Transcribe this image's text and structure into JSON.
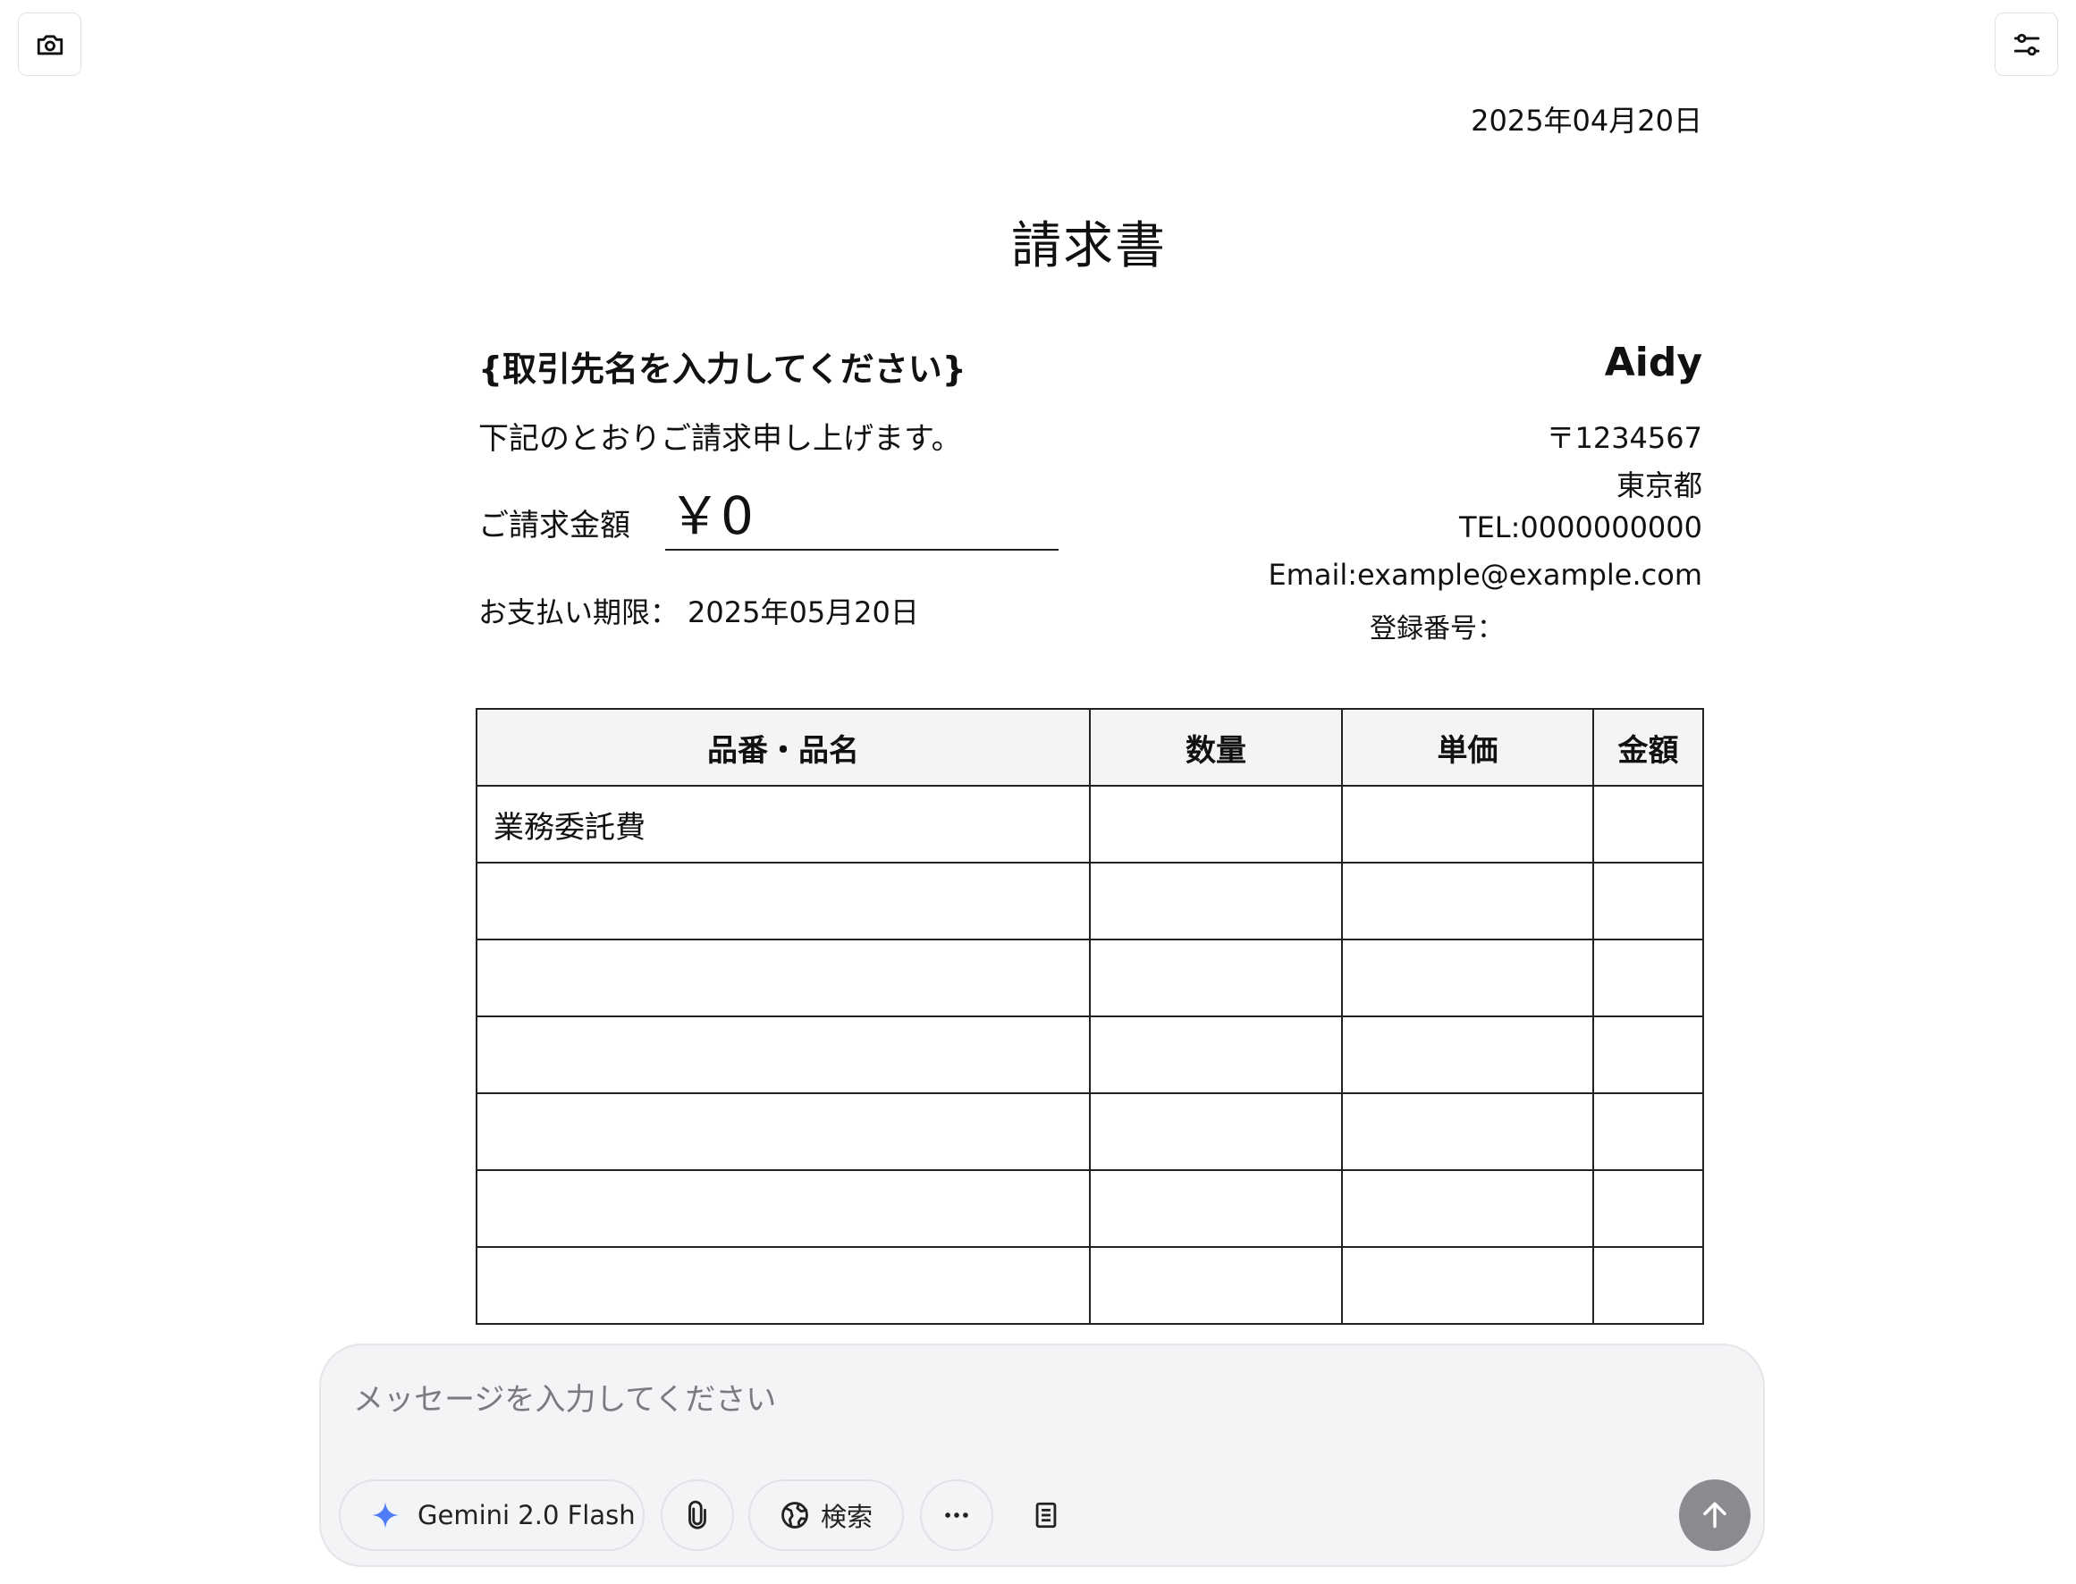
{
  "icons": {
    "camera": "camera-icon",
    "filter": "sliders-icon",
    "model": "sparkle-icon",
    "attach": "paperclip-icon",
    "search": "globe-icon",
    "more": "more-dots-icon",
    "document": "document-icon",
    "send": "arrow-up-icon"
  },
  "invoice": {
    "date": "2025年04月20日",
    "title": "請求書",
    "client": "{取引先名を入力してください}",
    "intro": "下記のとおりご請求申し上げます。",
    "amount_label": "ご請求金額",
    "amount_value": "￥0",
    "due_label": "お支払い期限：",
    "due_date": "2025年05月20日",
    "company": "Aidy",
    "postal": "〒1234567",
    "prefecture": "東京都",
    "tel": "TEL:0000000000",
    "email": "Email:example@example.com",
    "registration_label": "登録番号："
  },
  "table": {
    "headers": [
      "品番・品名",
      "数量",
      "単価",
      "金額"
    ],
    "rows": [
      [
        "業務委託費",
        "",
        "",
        ""
      ],
      [
        "",
        "",
        "",
        ""
      ],
      [
        "",
        "",
        "",
        ""
      ],
      [
        "",
        "",
        "",
        ""
      ],
      [
        "",
        "",
        "",
        ""
      ],
      [
        "",
        "",
        "",
        ""
      ],
      [
        "",
        "",
        "",
        ""
      ]
    ]
  },
  "chat": {
    "placeholder": "メッセージを入力してください",
    "model_label": "Gemini 2.0 Flash",
    "search_label": "検索"
  },
  "colors": {
    "send_button": "#8b8b8f",
    "sparkle": "#4f7cf7",
    "table_header_bg": "#f3f4f6"
  }
}
